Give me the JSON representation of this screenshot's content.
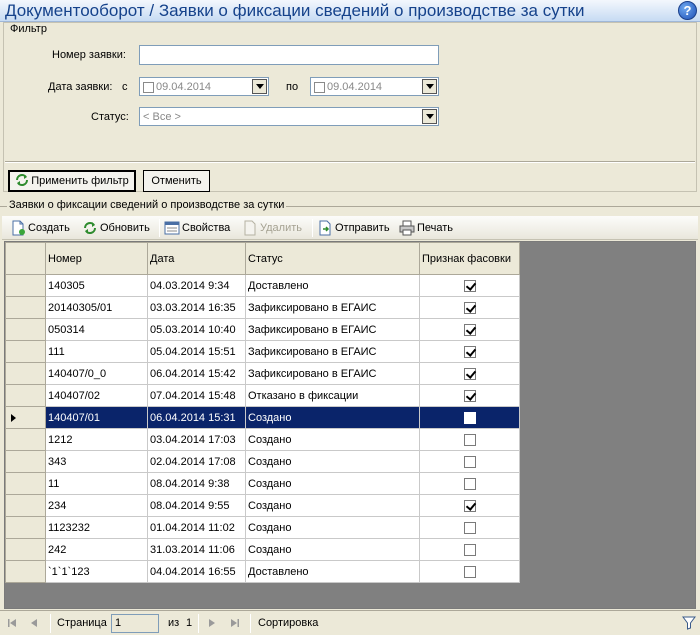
{
  "window": {
    "title": "Документооборот / Заявки о фиксации сведений о производстве за сутки",
    "help_icon": "help-icon"
  },
  "filter": {
    "legend": "Фильтр",
    "request_number_label": "Номер заявки:",
    "request_number_value": "",
    "date_label": "Дата заявки:",
    "date_from_label": "с",
    "date_from_value": "09.04.2014",
    "date_to_label": "по",
    "date_to_value": "09.04.2014",
    "status_label": "Статус:",
    "status_value": "< Все >",
    "apply_label": "Применить фильтр",
    "cancel_label": "Отменить"
  },
  "list": {
    "legend": "Заявки о фиксации сведений о производстве за сутки",
    "toolbar": {
      "create": "Создать",
      "refresh": "Обновить",
      "properties": "Свойства",
      "delete": "Удалить",
      "send": "Отправить",
      "print": "Печать"
    },
    "columns": [
      "Номер",
      "Дата",
      "Статус",
      "Признак фасовки"
    ],
    "selected_row": 6,
    "rows": [
      {
        "number": "140305",
        "date": "04.03.2014 9:34",
        "status": "Доставлено",
        "packed": true
      },
      {
        "number": "20140305/01",
        "date": "03.03.2014 16:35",
        "status": "Зафиксировано в ЕГАИС",
        "packed": true
      },
      {
        "number": "050314",
        "date": "05.03.2014 10:40",
        "status": "Зафиксировано в ЕГАИС",
        "packed": true
      },
      {
        "number": "111",
        "date": "05.04.2014 15:51",
        "status": "Зафиксировано в ЕГАИС",
        "packed": true
      },
      {
        "number": "140407/0_0",
        "date": "06.04.2014 15:42",
        "status": "Зафиксировано в ЕГАИС",
        "packed": true
      },
      {
        "number": "140407/02",
        "date": "07.04.2014 15:48",
        "status": "Отказано в фиксации",
        "packed": true
      },
      {
        "number": "140407/01",
        "date": "06.04.2014 15:31",
        "status": "Создано",
        "packed": false
      },
      {
        "number": "1212",
        "date": "03.04.2014 17:03",
        "status": "Создано",
        "packed": false
      },
      {
        "number": "343",
        "date": "02.04.2014 17:08",
        "status": "Создано",
        "packed": false
      },
      {
        "number": "11",
        "date": "08.04.2014 9:38",
        "status": "Создано",
        "packed": false
      },
      {
        "number": "234",
        "date": "08.04.2014 9:55",
        "status": "Создано",
        "packed": true
      },
      {
        "number": "1123232",
        "date": "01.04.2014 11:02",
        "status": "Создано",
        "packed": false
      },
      {
        "number": "242",
        "date": "31.03.2014 11:06",
        "status": "Создано",
        "packed": false
      },
      {
        "number": "`1`1`123",
        "date": "04.04.2014 16:55",
        "status": "Доставлено",
        "packed": false
      }
    ]
  },
  "pager": {
    "page_label": "Страница",
    "page_value": "1",
    "of_label": "из",
    "total_pages": "1",
    "sort_label": "Сортировка"
  },
  "colors": {
    "title_text": "#15428b",
    "selection": "#0a246a",
    "panel": "#ece9d8",
    "grid_empty": "#808080"
  }
}
